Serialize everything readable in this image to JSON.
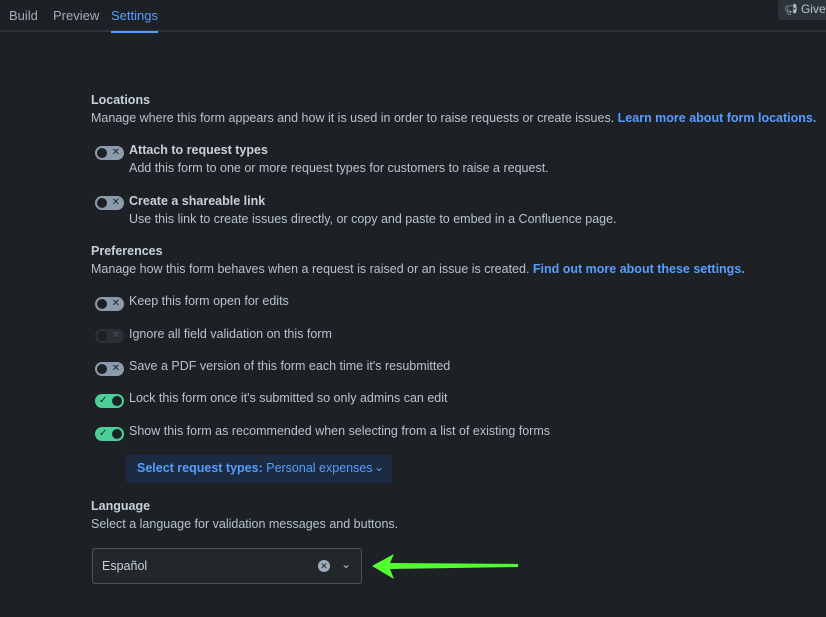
{
  "tabs": [
    {
      "label": "Build",
      "active": false
    },
    {
      "label": "Preview",
      "active": false
    },
    {
      "label": "Settings",
      "active": true
    }
  ],
  "feedback": {
    "label": "Give",
    "icon": "megaphone-icon"
  },
  "locations": {
    "title": "Locations",
    "description": "Manage where this form appears and how it is used in order to raise requests or create issues.",
    "link": "Learn more about form locations.",
    "options": [
      {
        "title": "Attach to request types",
        "description": "Add this form to one or more request types for customers to raise a request.",
        "state": "off"
      },
      {
        "title": "Create a shareable link",
        "description": "Use this link to create issues directly, or copy and paste to embed in a Confluence page.",
        "state": "off"
      }
    ]
  },
  "preferences": {
    "title": "Preferences",
    "description": "Manage how this form behaves when a request is raised or an issue is created.",
    "link": "Find out more about these settings.",
    "options": [
      {
        "label": "Keep this form open for edits",
        "state": "off"
      },
      {
        "label": "Ignore all field validation on this form",
        "state": "disabled"
      },
      {
        "label": "Save a PDF version of this form each time it's resubmitted",
        "state": "off"
      },
      {
        "label": "Lock this form once it's submitted so only admins can edit",
        "state": "on"
      },
      {
        "label": "Show this form as recommended when selecting from a list of existing forms",
        "state": "on"
      }
    ],
    "request_types_button": {
      "label": "Select request types:",
      "value": "Personal expenses"
    }
  },
  "language": {
    "title": "Language",
    "description": "Select a language for validation messages and buttons.",
    "selected": "Español"
  },
  "colors": {
    "accent": "#579dff",
    "toggle_on": "#4bce97",
    "annotation_arrow": "#52ff2f"
  }
}
